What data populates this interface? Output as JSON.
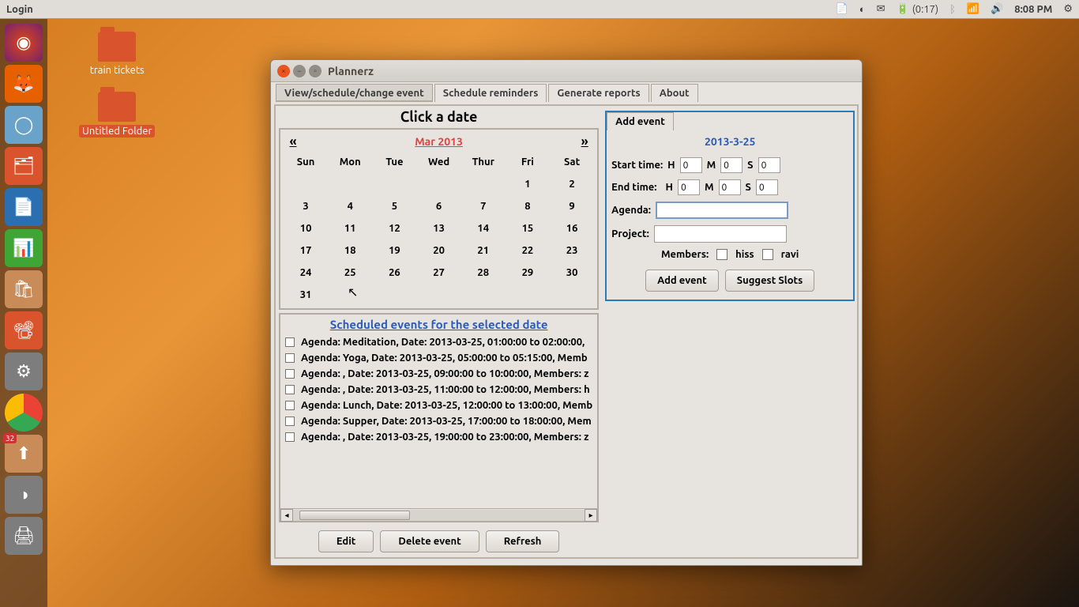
{
  "topbar": {
    "menu_label": "Login",
    "battery": "(0:17)",
    "time": "8:08 PM"
  },
  "desktop": {
    "folder1_label": "train tickets",
    "folder2_label": "Untitled Folder"
  },
  "launcher": {
    "updates_badge": "32"
  },
  "window": {
    "title": "Plannerz"
  },
  "tabs": {
    "t1": "View/schedule/change event",
    "t2": "Schedule reminders",
    "t3": "Generate reports",
    "t4": "About"
  },
  "calendar": {
    "title": "Click a date",
    "prev": "«",
    "next": "»",
    "month": "Mar 2013",
    "days": [
      "Sun",
      "Mon",
      "Tue",
      "Wed",
      "Thur",
      "Fri",
      "Sat"
    ],
    "cells": [
      "",
      "",
      "",
      "",
      "",
      "1",
      "2",
      "3",
      "4",
      "5",
      "6",
      "7",
      "8",
      "9",
      "10",
      "11",
      "12",
      "13",
      "14",
      "15",
      "16",
      "17",
      "18",
      "19",
      "20",
      "21",
      "22",
      "23",
      "24",
      "25",
      "26",
      "27",
      "28",
      "29",
      "30",
      "31",
      "",
      "",
      "",
      "",
      "",
      ""
    ]
  },
  "side": {
    "tab": "Add event",
    "date": "2013-3-25",
    "start_label": "Start time:",
    "end_label": "End time:",
    "H": "H",
    "M": "M",
    "S": "S",
    "h1": "0",
    "m1": "0",
    "s1": "0",
    "h2": "0",
    "m2": "0",
    "s2": "0",
    "agenda_label": "Agenda:",
    "project_label": "Project:",
    "members_label": "Members:",
    "member1": "hiss",
    "member2": "ravi",
    "add_btn": "Add event",
    "suggest_btn": "Suggest Slots"
  },
  "events": {
    "title": "Scheduled events for the selected date",
    "items": [
      "Agenda: Meditation, Date: 2013-03-25, 01:00:00 to 02:00:00, ",
      "Agenda: Yoga, Date: 2013-03-25, 05:00:00 to 05:15:00, Memb",
      "Agenda: , Date: 2013-03-25, 09:00:00 to 10:00:00, Members: z",
      "Agenda: , Date: 2013-03-25, 11:00:00 to 12:00:00, Members: h",
      "Agenda: Lunch, Date: 2013-03-25, 12:00:00 to 13:00:00, Memb",
      "Agenda: Supper, Date: 2013-03-25, 17:00:00 to 18:00:00, Mem",
      "Agenda: , Date: 2013-03-25, 19:00:00 to 23:00:00, Members: z"
    ]
  },
  "bottom": {
    "edit": "Edit",
    "delete": "Delete event",
    "refresh": "Refresh"
  }
}
